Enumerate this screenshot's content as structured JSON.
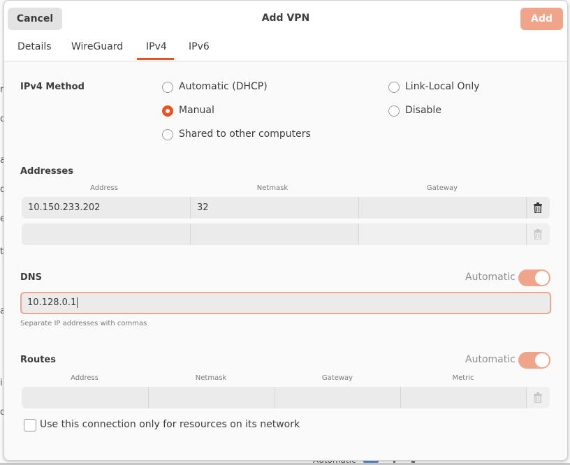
{
  "background": {
    "left_letters": [
      "ro",
      "o",
      "a",
      "o",
      "e",
      "t",
      "a",
      "i",
      "o"
    ],
    "bottom_text": "Automatic"
  },
  "header": {
    "cancel_label": "Cancel",
    "title": "Add VPN",
    "add_label": "Add"
  },
  "tabs": [
    {
      "label": "Details"
    },
    {
      "label": "WireGuard"
    },
    {
      "label": "IPv4",
      "active": true
    },
    {
      "label": "IPv6"
    }
  ],
  "ipv4_method": {
    "label": "IPv4 Method",
    "options": [
      {
        "label": "Automatic (DHCP)",
        "checked": false
      },
      {
        "label": "Manual",
        "checked": true
      },
      {
        "label": "Shared to other computers",
        "checked": false
      },
      {
        "label": "Link-Local Only",
        "checked": false
      },
      {
        "label": "Disable",
        "checked": false
      }
    ]
  },
  "addresses": {
    "label": "Addresses",
    "columns": [
      "Address",
      "Netmask",
      "Gateway"
    ],
    "rows": [
      [
        "10.150.233.202",
        "32",
        ""
      ],
      [
        "",
        "",
        ""
      ]
    ]
  },
  "dns": {
    "label": "DNS",
    "automatic_label": "Automatic",
    "automatic_on": true,
    "value": "10.128.0.1",
    "hint": "Separate IP addresses with commas"
  },
  "routes": {
    "label": "Routes",
    "automatic_label": "Automatic",
    "automatic_on": true,
    "columns": [
      "Address",
      "Netmask",
      "Gateway",
      "Metric"
    ],
    "rows": [
      [
        "",
        "",
        "",
        ""
      ]
    ]
  },
  "only_resources": {
    "label": "Use this connection only for resources on its network",
    "checked": false
  },
  "colors": {
    "accent": "#e95420",
    "accent_light": "#f0a58a"
  }
}
